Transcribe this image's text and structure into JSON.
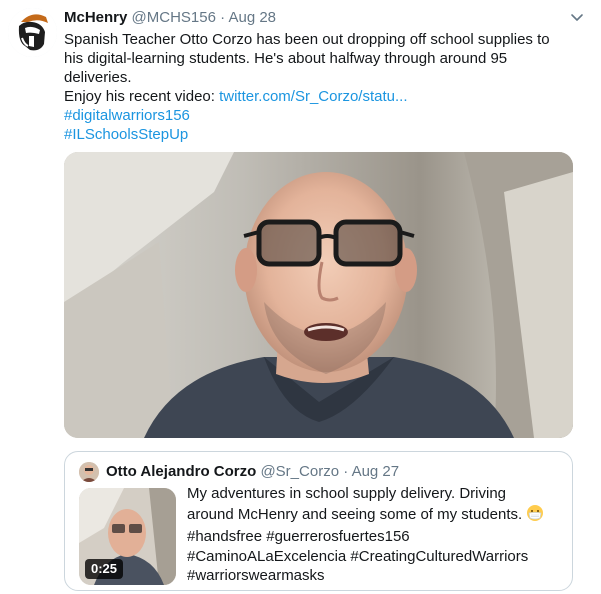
{
  "tweet": {
    "display_name": "McHenry",
    "handle": "@MCHS156",
    "separator": "·",
    "date": "Aug 28",
    "lines": [
      "Spanish Teacher Otto Corzo has been out dropping off school supplies to",
      "his digital-learning students. He's about halfway through around 95",
      "deliveries."
    ],
    "enjoy_prefix": "Enjoy his recent video: ",
    "video_link": "twitter.com/Sr_Corzo/statu...",
    "hashtags": [
      "#digitalwarriors156",
      "#ILSchoolsStepUp"
    ],
    "link_color": "#1b95e0"
  },
  "quoted": {
    "display_name": "Otto Alejandro Corzo",
    "handle": "@Sr_Corzo",
    "separator": "·",
    "date": "Aug 27",
    "duration": "0:25",
    "lines": [
      "My adventures in school supply delivery. Driving",
      "around McHenry and seeing some of my students."
    ],
    "hashtag_lines": [
      "#handsfree #guerrerosfuertes156",
      "#CaminoALaExcelencia #CreatingCulturedWarriors",
      "#warriorswearmasks"
    ],
    "emoji": "mask-emoji"
  },
  "icons": {
    "avatar": "spartan-helmet-icon",
    "menu": "chevron-down-icon"
  }
}
